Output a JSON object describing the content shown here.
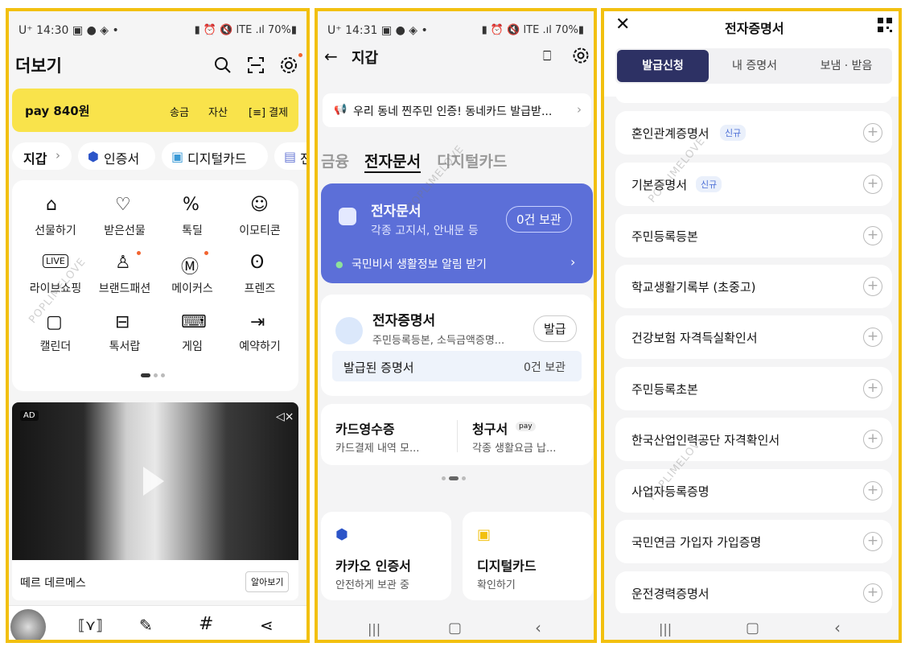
{
  "p1": {
    "time": "14:30",
    "carrier": "U⁺",
    "battery": "70%",
    "title": "더보기",
    "pay_amount": "pay 840원",
    "pay_actions": [
      "송금",
      "자산",
      "결제"
    ],
    "chips": [
      "지갑",
      "인증서",
      "디지털카드",
      "전"
    ],
    "tiles": [
      {
        "label": "선물하기",
        "icon": "gift-icon"
      },
      {
        "label": "받은선물",
        "icon": "received-gift-icon"
      },
      {
        "label": "톡딜",
        "icon": "percent-icon"
      },
      {
        "label": "이모티콘",
        "icon": "emoticon-icon"
      },
      {
        "label": "라이브쇼핑",
        "icon": "live-icon"
      },
      {
        "label": "브랜드패션",
        "icon": "hanger-icon"
      },
      {
        "label": "메이커스",
        "icon": "makers-icon"
      },
      {
        "label": "프렌즈",
        "icon": "friends-icon"
      },
      {
        "label": "캘린더",
        "icon": "calendar-icon"
      },
      {
        "label": "톡서랍",
        "icon": "drawer-icon"
      },
      {
        "label": "게임",
        "icon": "gamepad-icon"
      },
      {
        "label": "예약하기",
        "icon": "reservation-icon"
      }
    ],
    "ad_badge": "AD",
    "ad_title": "떼르 데르메스",
    "ad_button": "알아보기",
    "watermark": "POPLIMELOVE"
  },
  "p2": {
    "time": "14:31",
    "battery": "70%",
    "title": "지갑",
    "notice": "우리 동네 찐주민 인증! 동네카드 발급받...",
    "tabs": [
      "금융",
      "전자문서",
      "디지털카드"
    ],
    "edoc_title": "전자문서",
    "edoc_sub": "각종 고지서, 안내문 등",
    "edoc_count": "0건 보관",
    "edoc_alert": "국민비서 생활정보 알림 받기",
    "cert_title": "전자증명서",
    "cert_sub": "주민등록등본, 소득금액증명...",
    "cert_button": "발급",
    "cert_issued": "발급된 증명서",
    "cert_count": "0건 보관",
    "receipt_title": "카드영수증",
    "receipt_sub": "카드결제 내역 모...",
    "bill_title": "청구서",
    "bill_badge": "pay",
    "bill_sub": "각종 생활요금 납...",
    "kakao_cert_title": "카카오 인증서",
    "kakao_cert_sub": "안전하게 보관 중",
    "dcard_title": "디지털카드",
    "dcard_sub": "확인하기",
    "watermark": "POPLIMELOVE"
  },
  "p3": {
    "title": "전자증명서",
    "tabs": [
      "발급신청",
      "내 증명서",
      "보냄 · 받음"
    ],
    "new_badge": "신규",
    "items": [
      "혼인관계증명서",
      "기본증명서",
      "주민등록등본",
      "학교생활기록부 (초중고)",
      "건강보험 자격득실확인서",
      "주민등록초본",
      "한국산업인력공단 자격확인서",
      "사업자등록증명",
      "국민연금 가입자 가입증명",
      "운전경력증명서"
    ],
    "plus": "+",
    "watermark": "POPLIMELOVE"
  }
}
